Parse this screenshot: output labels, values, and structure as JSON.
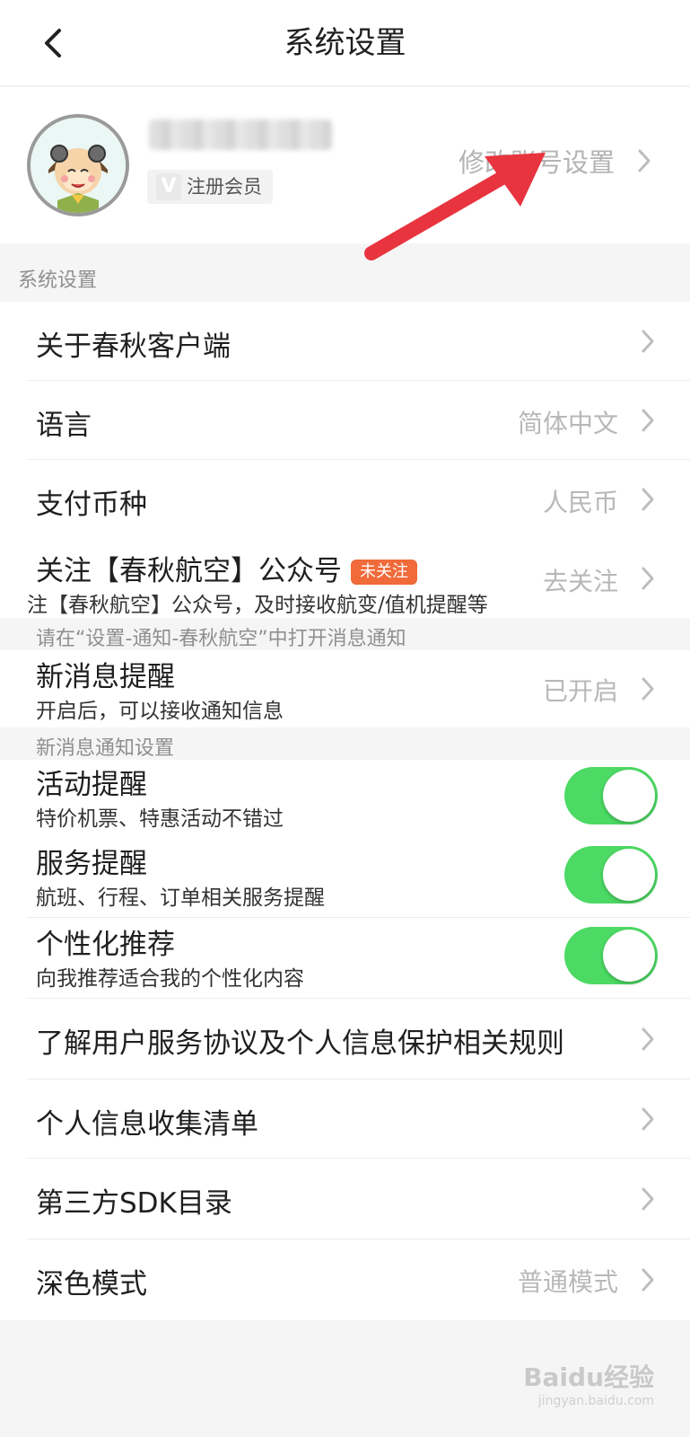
{
  "nav": {
    "title": "系统设置",
    "back_icon": "chevron-left-icon"
  },
  "account": {
    "member_label": "注册会员",
    "member_badge_letter": "V",
    "edit_label": "修改账号设置"
  },
  "sections": {
    "system": "系统设置",
    "wechat_hint": "请在“设置-通知-春秋航空”中打开消息通知",
    "notify": "新消息通知设置"
  },
  "rows": {
    "about": {
      "title": "关于春秋客户端"
    },
    "language": {
      "title": "语言",
      "value": "简体中文"
    },
    "currency": {
      "title": "支付币种",
      "value": "人民币"
    },
    "follow": {
      "title": "关注【春秋航空】公众号",
      "tag": "未关注",
      "subtitle": "注【春秋航空】公众号，及时接收航变/值机提醒等",
      "value": "去关注"
    },
    "new_msg": {
      "title": "新消息提醒",
      "subtitle": "开启后，可以接收通知信息",
      "value": "已开启"
    },
    "activity": {
      "title": "活动提醒",
      "subtitle": "特价机票、特惠活动不错过",
      "enabled": true
    },
    "service": {
      "title": "服务提醒",
      "subtitle": "航班、行程、订单相关服务提醒",
      "enabled": true
    },
    "personalized": {
      "title": "个性化推荐",
      "subtitle": "向我推荐适合我的个性化内容",
      "enabled": true
    },
    "agreement": {
      "title": "了解用户服务协议及个人信息保护相关规则"
    },
    "collection": {
      "title": "个人信息收集清单"
    },
    "sdk": {
      "title": "第三方SDK目录"
    },
    "dark_mode": {
      "title": "深色模式",
      "value": "普通模式"
    }
  },
  "watermark": {
    "text": "Baidu经验",
    "domain": "jingyan.baidu.com"
  },
  "colors": {
    "toggle_on": "#4cd964",
    "tag_bg": "#f06a3a",
    "arrow": "#e8343f"
  }
}
